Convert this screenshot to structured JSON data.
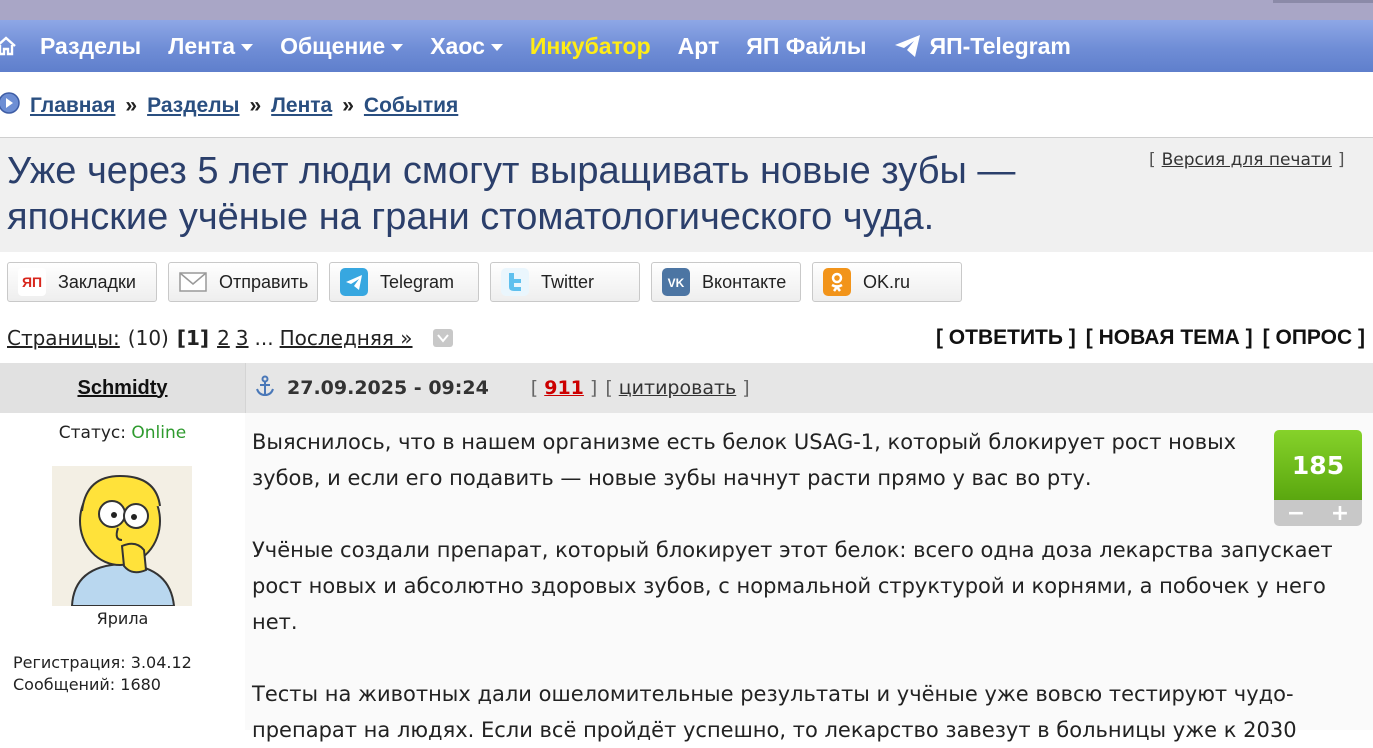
{
  "nav": {
    "items": [
      {
        "label": "Разделы",
        "dropdown": false,
        "highlight": false
      },
      {
        "label": "Лента",
        "dropdown": true,
        "highlight": false
      },
      {
        "label": "Общение",
        "dropdown": true,
        "highlight": false
      },
      {
        "label": "Хаос",
        "dropdown": true,
        "highlight": false
      },
      {
        "label": "Инкубатор",
        "dropdown": false,
        "highlight": true
      },
      {
        "label": "Арт",
        "dropdown": false,
        "highlight": false
      },
      {
        "label": "ЯП Файлы",
        "dropdown": false,
        "highlight": false
      }
    ],
    "telegram_label": "ЯП-Telegram"
  },
  "breadcrumb": {
    "items": [
      "Главная",
      "Разделы",
      "Лента",
      "События"
    ],
    "separator": "»"
  },
  "topic": {
    "title": "Уже через 5 лет люди смогут выращивать новые зубы — японские учёные на грани стоматологического чуда.",
    "print_link": "Версия для печати",
    "bracket_open": "[",
    "bracket_close": "]"
  },
  "share": [
    {
      "label": "Закладки",
      "icon": "yap-icon",
      "color": "#d8261c",
      "glyph": "ЯП"
    },
    {
      "label": "Отправить",
      "icon": "mail-icon",
      "color": "#ffffff",
      "glyph": ""
    },
    {
      "label": "Telegram",
      "icon": "telegram-icon",
      "color": "#37a7e0",
      "glyph": ""
    },
    {
      "label": "Twitter",
      "icon": "twitter-icon",
      "color": "#5fc0ee",
      "glyph": ""
    },
    {
      "label": "Вконтакте",
      "icon": "vk-icon",
      "color": "#4c75a3",
      "glyph": "VK"
    },
    {
      "label": "OK.ru",
      "icon": "ok-icon",
      "color": "#f2941a",
      "glyph": "ok"
    }
  ],
  "pagination": {
    "label": "Страницы:",
    "total": "(10)",
    "current": "[1]",
    "pages": [
      "2",
      "3"
    ],
    "ellipsis": "...",
    "last": "Последняя »"
  },
  "actions": {
    "reply": "[ ОТВЕТИТЬ ]",
    "new_topic": "[ НОВАЯ ТЕМА ]",
    "poll": "[ ОПРОС ]"
  },
  "post": {
    "author": "Schmidty",
    "date": "27.09.2025 - 09:24",
    "number": "911",
    "quote": "цитировать",
    "status_label": "Статус:",
    "status_value": "Online",
    "nickname": "Ярила",
    "registration": "Регистрация: 3.04.12",
    "messages": "Сообщений: 1680",
    "rating": "185",
    "paragraphs": [
      "Выяснилось, что в нашем организме есть белок USAG-1, который блокирует рост новых зубов, и если его подавить — новые зубы начнут расти прямо у вас во рту.",
      "Учёные создали препарат, который блокирует этот белок: всего одна доза лекарства запускает рост новых и абсолютно здоровых зубов, с нормальной структурой и корнями, а побочек у него нет.",
      "Тесты на животных дали ошеломительные результаты и учёные уже вовсю тестируют чудо-препарат на людях. Если всё пройдёт успешно, то лекарство завезут в больницы уже к 2030"
    ]
  },
  "colors": {
    "nav_bg": "#6f8dd6",
    "nav_highlight": "#ffec16",
    "link": "#2a4f80",
    "online": "#2e9a2e",
    "rating_green": "#6fbd1a",
    "post_number": "#cc0000"
  }
}
